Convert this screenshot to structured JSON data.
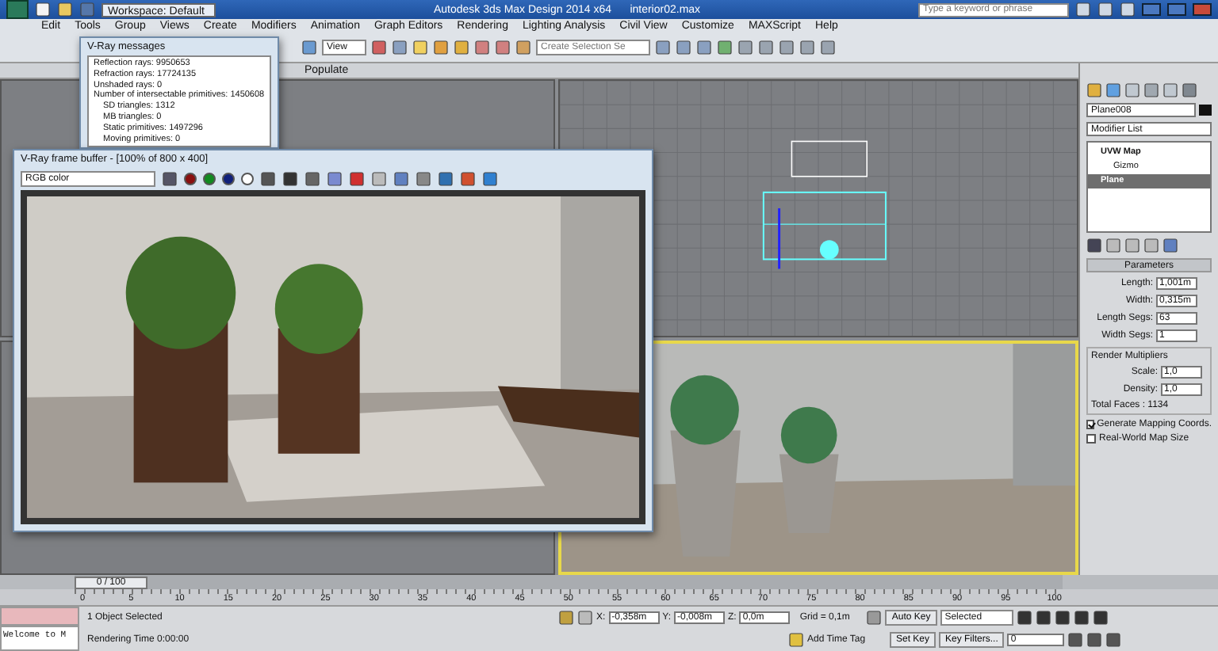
{
  "title_bar": {
    "workspace": "Workspace: Default",
    "title": "Autodesk 3ds Max Design 2014 x64      interior02.max",
    "search": {
      "placeholder": "Type a keyword or phrase"
    }
  },
  "menu": [
    "Edit",
    "Tools",
    "Group",
    "Views",
    "Create",
    "Modifiers",
    "Animation",
    "Graph Editors",
    "Rendering",
    "Lighting Analysis",
    "Civil View",
    "Customize",
    "MAXScript",
    "Help"
  ],
  "toolbar": {
    "view_dropdown": "View",
    "selection_set": {
      "placeholder": "Create Selection Se"
    }
  },
  "ribbon": {
    "tab": "Populate"
  },
  "vray_messages": {
    "title": "V-Ray messages",
    "lines": [
      "Reflection rays: 9950653",
      "Refraction rays: 17724135",
      "Unshaded rays: 0",
      "Number of intersectable primitives: 1450608",
      "SD triangles: 1312",
      "MB triangles: 0",
      "Static primitives: 1497296",
      "Moving primitives: 0"
    ]
  },
  "frame_buffer": {
    "title": "V-Ray frame buffer - [100% of 800 x 400]",
    "channel": "RGB color"
  },
  "command_panel": {
    "object_name": "Plane008",
    "modifier_list": "Modifier List",
    "stack": [
      {
        "label": "UVW Map",
        "selected": false,
        "children": [
          {
            "label": "Gizmo",
            "selected": false
          }
        ]
      },
      {
        "label": "Plane",
        "selected": true
      }
    ],
    "rollout": "Parameters",
    "fields": [
      {
        "label": "Length:",
        "value": "1,001m"
      },
      {
        "label": "Width:",
        "value": "0,315m"
      },
      {
        "label": "Length Segs:",
        "value": "63"
      },
      {
        "label": "Width Segs:",
        "value": "1"
      }
    ],
    "group_title": "Render Multipliers",
    "multipliers": [
      {
        "label": "Scale:",
        "value": "1,0"
      },
      {
        "label": "Density:",
        "value": "1,0"
      }
    ],
    "total_faces": "Total Faces : 1134",
    "checkboxes": [
      {
        "label": "Generate Mapping Coords.",
        "checked": true
      },
      {
        "label": "Real-World Map Size",
        "checked": false
      }
    ]
  },
  "time_slider": {
    "label": "0 / 100",
    "level": 0
  },
  "ruler_ticks": [
    "0",
    "5",
    "10",
    "15",
    "20",
    "25",
    "30",
    "35",
    "40",
    "45",
    "50",
    "55",
    "60",
    "65",
    "70",
    "75",
    "80",
    "85",
    "90",
    "95",
    "100"
  ],
  "status": {
    "script": "Welcome to M",
    "selection": "1 Object Selected",
    "prompt": "Rendering Time  0:00:00",
    "coords": [
      {
        "axis": "X:",
        "value": "-0,358m"
      },
      {
        "axis": "Y:",
        "value": "-0,008m"
      },
      {
        "axis": "Z:",
        "value": "0,0m"
      }
    ],
    "grid": "Grid = 0,1m",
    "add_time_tag": "Add Time Tag",
    "auto_key": "Auto Key",
    "key_mode": "Selected",
    "set_key": "Set Key",
    "key_filters": "Key Filters...",
    "frame": "0"
  }
}
